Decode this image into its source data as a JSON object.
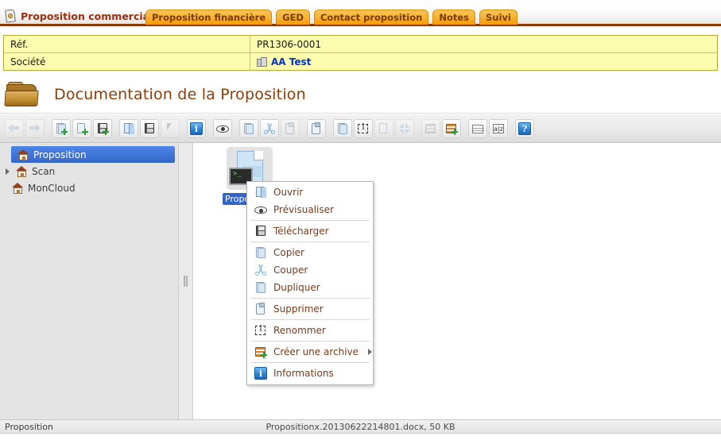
{
  "tabbar": {
    "active_title": "Proposition commerciale",
    "active_icon": "document-tag-icon",
    "tabs": [
      {
        "label": "Proposition financière"
      },
      {
        "label": "GED"
      },
      {
        "label": "Contact proposition"
      },
      {
        "label": "Notes"
      },
      {
        "label": "Suivi"
      }
    ]
  },
  "info": {
    "rows": [
      {
        "label": "Réf.",
        "value": "PR1306-0001",
        "link": false
      },
      {
        "label": "Société",
        "value": "AA Test",
        "link": true,
        "icon": "company-icon"
      }
    ]
  },
  "page": {
    "title": "Documentation de la Proposition",
    "icon": "folder-icon"
  },
  "toolbar": {
    "groups": [
      {
        "buttons": [
          {
            "name": "back-button",
            "icon": "arrow-left-icon",
            "disabled": true
          },
          {
            "name": "forward-button",
            "icon": "arrow-right-icon",
            "disabled": true
          }
        ]
      },
      {
        "buttons": [
          {
            "name": "new-folder-button",
            "icon": "folder-add-icon",
            "disabled": false
          },
          {
            "name": "new-file-button",
            "icon": "file-add-icon",
            "disabled": false
          },
          {
            "name": "save-button",
            "icon": "floppy-add-icon",
            "disabled": false
          }
        ]
      },
      {
        "buttons": [
          {
            "name": "open-button",
            "icon": "door-open-icon",
            "disabled": false
          },
          {
            "name": "download-button",
            "icon": "floppy-icon",
            "disabled": false
          },
          {
            "name": "select-button",
            "icon": "cursor-icon",
            "disabled": true
          }
        ]
      },
      {
        "buttons": [
          {
            "name": "information-button",
            "icon": "info-icon",
            "disabled": false
          }
        ]
      },
      {
        "buttons": [
          {
            "name": "preview-button",
            "icon": "eye-icon",
            "disabled": false
          }
        ]
      },
      {
        "buttons": [
          {
            "name": "copy-button",
            "icon": "copy-icon",
            "disabled": false
          },
          {
            "name": "cut-button",
            "icon": "scissors-icon",
            "disabled": false
          },
          {
            "name": "paste-button",
            "icon": "paste-icon",
            "disabled": true
          }
        ]
      },
      {
        "buttons": [
          {
            "name": "delete-button",
            "icon": "trash-clipboard-icon",
            "disabled": false
          }
        ]
      },
      {
        "buttons": [
          {
            "name": "duplicate-button",
            "icon": "duplicate-icon",
            "disabled": false
          },
          {
            "name": "rename-button",
            "icon": "rename-icon",
            "disabled": false
          },
          {
            "name": "edit-button",
            "icon": "pencil-page-icon",
            "disabled": true
          },
          {
            "name": "extract-button",
            "icon": "shrink-arrows-icon",
            "disabled": true
          }
        ]
      },
      {
        "buttons": [
          {
            "name": "archive-button",
            "icon": "archive-icon",
            "disabled": true
          },
          {
            "name": "create-archive-button",
            "icon": "archive-add-icon",
            "disabled": false
          }
        ]
      },
      {
        "buttons": [
          {
            "name": "grid-view-button",
            "icon": "grid-icon",
            "disabled": false
          },
          {
            "name": "sort-button",
            "icon": "sort-az-icon",
            "disabled": false
          }
        ]
      },
      {
        "buttons": [
          {
            "name": "help-button",
            "icon": "help-icon",
            "disabled": false
          }
        ]
      }
    ]
  },
  "sidebar": {
    "items": [
      {
        "label": "Proposition",
        "icon": "house-icon",
        "selected": true,
        "expandable": false
      },
      {
        "label": "Scan",
        "icon": "house-icon",
        "selected": false,
        "expandable": true
      },
      {
        "label": "MonCloud",
        "icon": "house-icon",
        "selected": false,
        "expandable": false
      }
    ]
  },
  "content": {
    "file": {
      "label": "Propositionx",
      "icon": "document-thumbnail-icon",
      "badge": "terminal-badge-icon"
    }
  },
  "context_menu": {
    "items": [
      {
        "label": "Ouvrir",
        "icon": "door-open-icon",
        "separator_after": false,
        "submenu": false
      },
      {
        "label": "Prévisualiser",
        "icon": "eye-icon",
        "separator_after": true,
        "submenu": false
      },
      {
        "label": "Télécharger",
        "icon": "floppy-icon",
        "separator_after": true,
        "submenu": false
      },
      {
        "label": "Copier",
        "icon": "copy-icon",
        "separator_after": false,
        "submenu": false
      },
      {
        "label": "Couper",
        "icon": "scissors-icon",
        "separator_after": false,
        "submenu": false
      },
      {
        "label": "Dupliquer",
        "icon": "duplicate-icon",
        "separator_after": true,
        "submenu": false
      },
      {
        "label": "Supprimer",
        "icon": "trash-clipboard-icon",
        "separator_after": true,
        "submenu": false
      },
      {
        "label": "Renommer",
        "icon": "rename-icon",
        "separator_after": true,
        "submenu": false
      },
      {
        "label": "Créer une archive",
        "icon": "archive-add-icon",
        "separator_after": true,
        "submenu": true
      },
      {
        "label": "Informations",
        "icon": "info-icon",
        "separator_after": false,
        "submenu": false
      }
    ]
  },
  "statusbar": {
    "left": "Proposition",
    "center": "Propositionx.20130622214801.docx, 50 KB"
  },
  "colors": {
    "tab_orange": "#f7a61c",
    "tab_border": "#8c3a00",
    "title_brown": "#9b2f11",
    "info_yellow": "#fdfdb0",
    "link_blue": "#0033cc",
    "selection_blue": "#3567c9",
    "menu_text": "#7a3a1a"
  }
}
